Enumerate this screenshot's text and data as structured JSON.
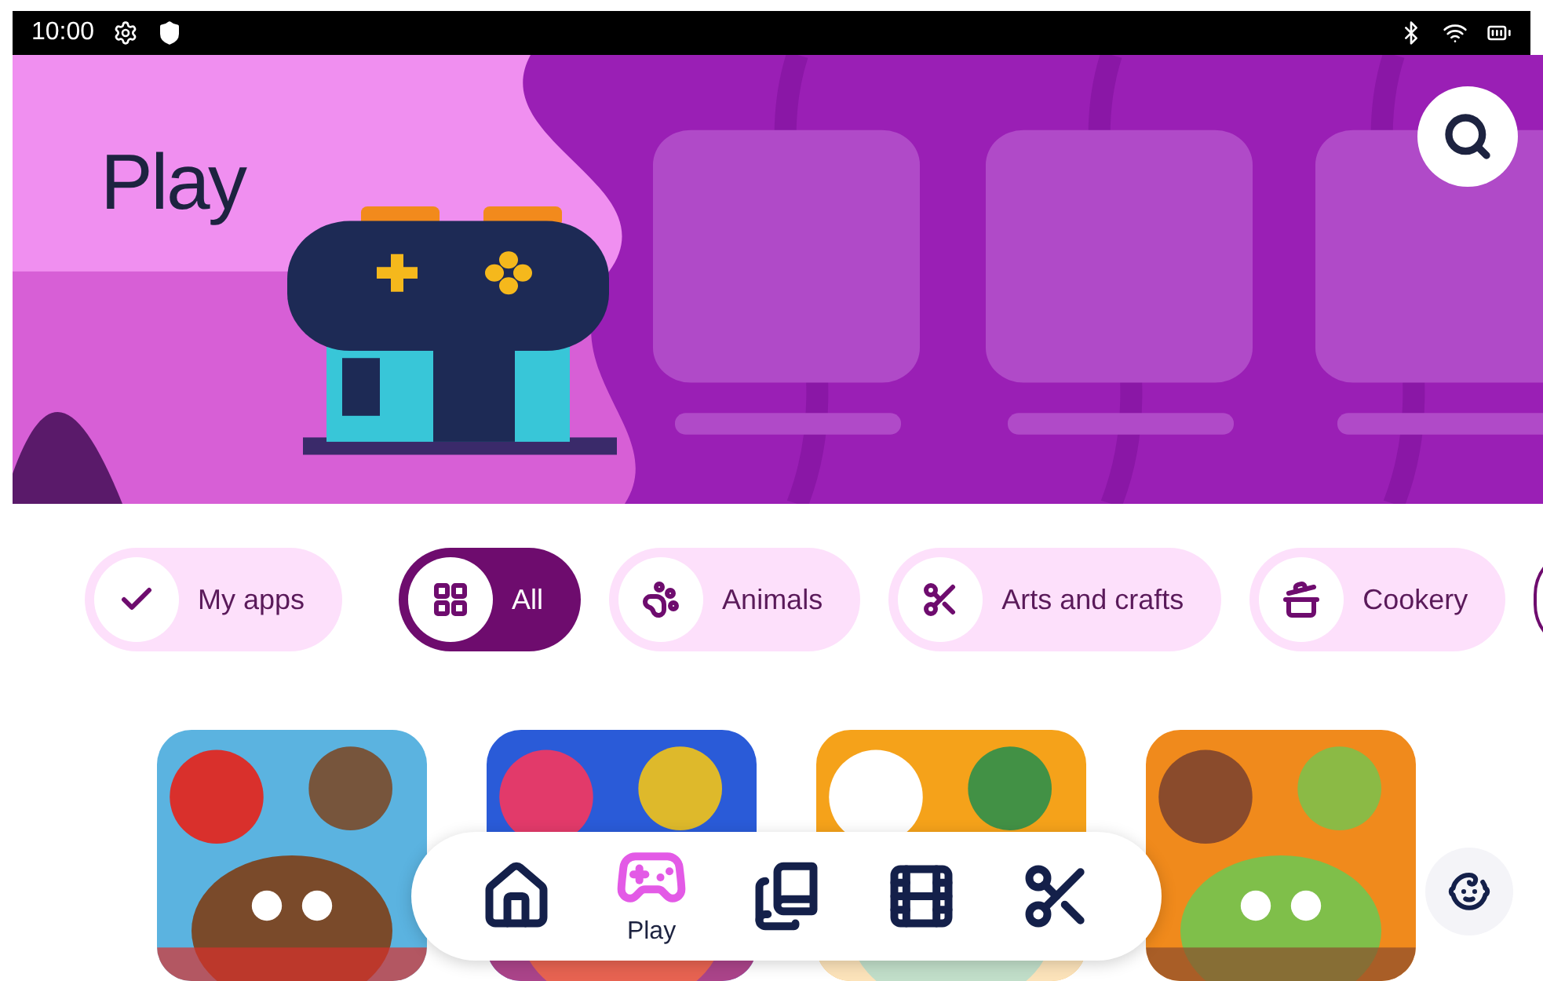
{
  "status_bar": {
    "time": "10:00"
  },
  "banner": {
    "title": "Play"
  },
  "categories": [
    {
      "label": "My apps",
      "kind": "check",
      "selected": false
    },
    {
      "label": "All",
      "kind": "grid",
      "selected": true
    },
    {
      "label": "Animals",
      "kind": "paw",
      "selected": false
    },
    {
      "label": "Arts and crafts",
      "kind": "scissors",
      "selected": false
    },
    {
      "label": "Cookery",
      "kind": "pot",
      "selected": false
    }
  ],
  "nav": [
    {
      "kind": "home",
      "selected": false
    },
    {
      "kind": "play",
      "selected": true,
      "label": "Play"
    },
    {
      "kind": "library",
      "selected": false
    },
    {
      "kind": "video",
      "selected": false
    },
    {
      "kind": "crafts",
      "selected": false
    }
  ]
}
